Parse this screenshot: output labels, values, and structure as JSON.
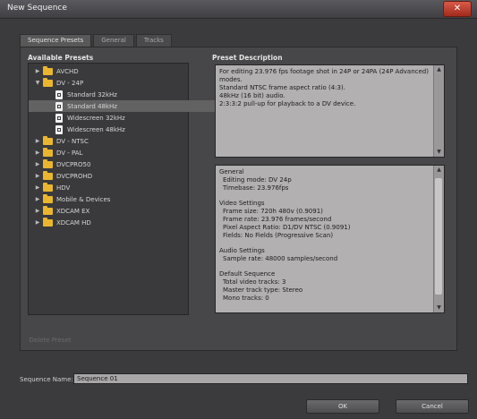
{
  "window": {
    "title": "New Sequence",
    "close_glyph": "✕"
  },
  "tabs": [
    {
      "label": "Sequence Presets"
    },
    {
      "label": "General"
    },
    {
      "label": "Tracks"
    }
  ],
  "presets": {
    "heading": "Available Presets",
    "items": [
      {
        "label": "AVCHD",
        "type": "folder",
        "expanded": false
      },
      {
        "label": "DV - 24P",
        "type": "folder",
        "expanded": true
      },
      {
        "label": "Standard 32kHz",
        "type": "preset"
      },
      {
        "label": "Standard 48kHz",
        "type": "preset",
        "selected": true
      },
      {
        "label": "Widescreen 32kHz",
        "type": "preset"
      },
      {
        "label": "Widescreen 48kHz",
        "type": "preset"
      },
      {
        "label": "DV - NTSC",
        "type": "folder",
        "expanded": false
      },
      {
        "label": "DV - PAL",
        "type": "folder",
        "expanded": false
      },
      {
        "label": "DVCPRO50",
        "type": "folder",
        "expanded": false
      },
      {
        "label": "DVCPROHD",
        "type": "folder",
        "expanded": false
      },
      {
        "label": "HDV",
        "type": "folder",
        "expanded": false
      },
      {
        "label": "Mobile & Devices",
        "type": "folder",
        "expanded": false
      },
      {
        "label": "XDCAM EX",
        "type": "folder",
        "expanded": false
      },
      {
        "label": "XDCAM HD",
        "type": "folder",
        "expanded": false
      }
    ]
  },
  "description": {
    "heading": "Preset Description",
    "lines": [
      "For editing 23.976 fps footage shot in 24P or 24PA (24P Advanced)",
      "modes.",
      "Standard NTSC frame aspect ratio (4:3).",
      "48kHz (16 bit) audio.",
      "2:3:3:2 pull-up for playback to a DV device."
    ]
  },
  "details": {
    "lines": [
      {
        "text": "General",
        "indent": false,
        "section": false
      },
      {
        "text": "Editing mode: DV 24p",
        "indent": true,
        "section": false
      },
      {
        "text": "Timebase: 23.976fps",
        "indent": true,
        "section": false
      },
      {
        "text": "Video Settings",
        "indent": false,
        "section": true
      },
      {
        "text": "Frame size: 720h 480v (0.9091)",
        "indent": true,
        "section": false
      },
      {
        "text": "Frame rate: 23.976 frames/second",
        "indent": true,
        "section": false
      },
      {
        "text": "Pixel Aspect Ratio: D1/DV NTSC (0.9091)",
        "indent": true,
        "section": false
      },
      {
        "text": "Fields: No Fields (Progressive Scan)",
        "indent": true,
        "section": false
      },
      {
        "text": "Audio Settings",
        "indent": false,
        "section": true
      },
      {
        "text": "Sample rate: 48000 samples/second",
        "indent": true,
        "section": false
      },
      {
        "text": "Default Sequence",
        "indent": false,
        "section": true
      },
      {
        "text": "Total video tracks: 3",
        "indent": true,
        "section": false
      },
      {
        "text": "Master track type: Stereo",
        "indent": true,
        "section": false
      },
      {
        "text": "Mono tracks: 0",
        "indent": true,
        "section": false
      }
    ]
  },
  "delete_button": {
    "label": "Delete Preset"
  },
  "sequence_name": {
    "label": "Sequence Name:",
    "value": "Sequence 01"
  },
  "buttons": {
    "ok": "OK",
    "cancel": "Cancel"
  },
  "colors": {
    "folder": "#e9b62d",
    "selected_row": "#626262",
    "close": "#c0392b"
  }
}
